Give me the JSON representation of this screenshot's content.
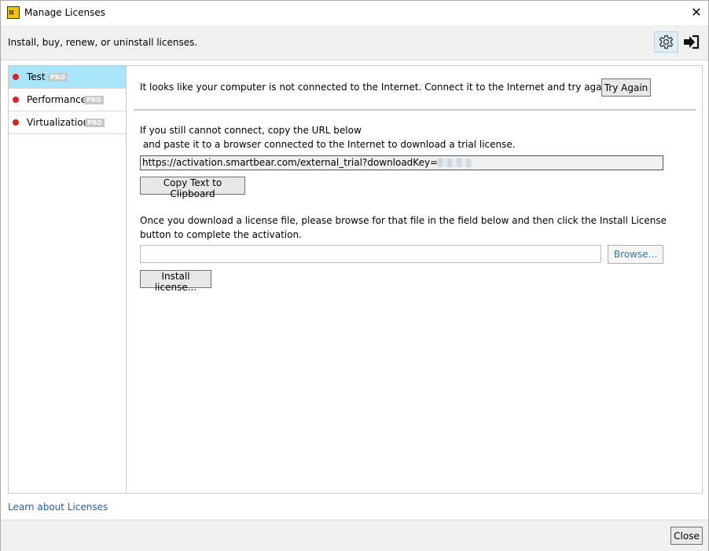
{
  "window": {
    "title": "Manage Licenses",
    "close_glyph": "✕"
  },
  "header": {
    "subtitle": "Install, buy, renew, or uninstall licenses.",
    "settings_icon": "gear-icon",
    "signin_icon": "sign-in-icon"
  },
  "sidebar": {
    "items": [
      {
        "label": "Test",
        "badge": "PRO",
        "selected": true,
        "status_color": "#e02020"
      },
      {
        "label": "Performance",
        "badge": "PRO",
        "selected": false,
        "status_color": "#e02020"
      },
      {
        "label": "Virtualization",
        "badge": "PRO",
        "selected": false,
        "status_color": "#e02020"
      }
    ]
  },
  "main": {
    "connection_message": "It looks like your computer is not connected to the Internet. Connect it to the Internet and try again.",
    "try_again_label": "Try Again",
    "still_cannot_line1": "If you still cannot connect, copy the URL below",
    "still_cannot_line2": " and paste it to a browser connected to the Internet to download a trial license.",
    "url_text": "https://activation.smartbear.com/external_trial?downloadKey=",
    "copy_label": "Copy Text to Clipboard",
    "instructions_line1": "Once you download a license file, please browse for that file in the field below and then click the Install License",
    "instructions_line2": "button to complete the activation.",
    "file_path_value": "",
    "browse_label": "Browse...",
    "install_label": "Install license..."
  },
  "footer": {
    "learn_link": "Learn about Licenses",
    "close_label": "Close"
  },
  "colors": {
    "selected_bg": "#a9e5f8",
    "status_red": "#e02020",
    "link_blue": "#1a5fb4"
  }
}
